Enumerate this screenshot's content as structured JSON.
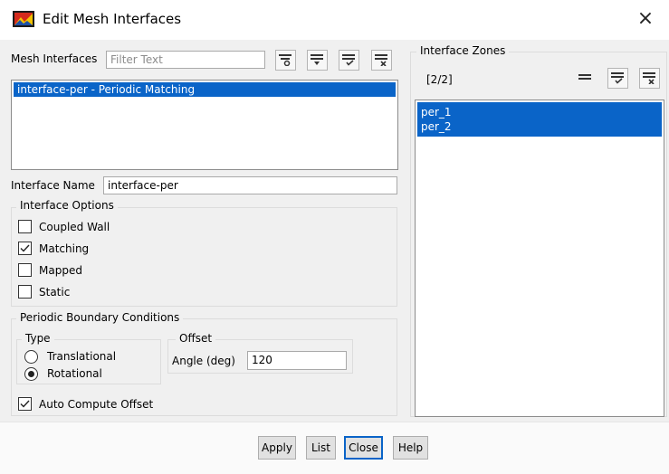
{
  "window": {
    "title": "Edit Mesh Interfaces",
    "close_glyph": "×"
  },
  "mesh_interfaces": {
    "label": "Mesh Interfaces",
    "filter_placeholder": "Filter Text",
    "items": [
      "interface-per - Periodic Matching"
    ]
  },
  "interface_name": {
    "label": "Interface Name",
    "value": "interface-per"
  },
  "interface_options": {
    "title": "Interface Options",
    "options": [
      {
        "label": "Coupled Wall",
        "checked": false
      },
      {
        "label": "Matching",
        "checked": true
      },
      {
        "label": "Mapped",
        "checked": false
      },
      {
        "label": "Static",
        "checked": false
      }
    ]
  },
  "periodic": {
    "title": "Periodic Boundary Conditions",
    "type_title": "Type",
    "types": [
      {
        "label": "Translational",
        "selected": false
      },
      {
        "label": "Rotational",
        "selected": true
      }
    ],
    "offset_title": "Offset",
    "angle_label": "Angle  (deg)",
    "angle_value": "120",
    "auto_compute_label": "Auto Compute Offset",
    "auto_compute_checked": true
  },
  "interface_zones": {
    "title": "Interface Zones",
    "count": "[2/2]",
    "items": [
      "per_1",
      "per_2"
    ]
  },
  "buttons": {
    "apply": "Apply",
    "list": "List",
    "close": "Close",
    "help": "Help"
  },
  "colors": {
    "selection": "#0a64c8",
    "panel_bg": "#f0f0f0"
  }
}
